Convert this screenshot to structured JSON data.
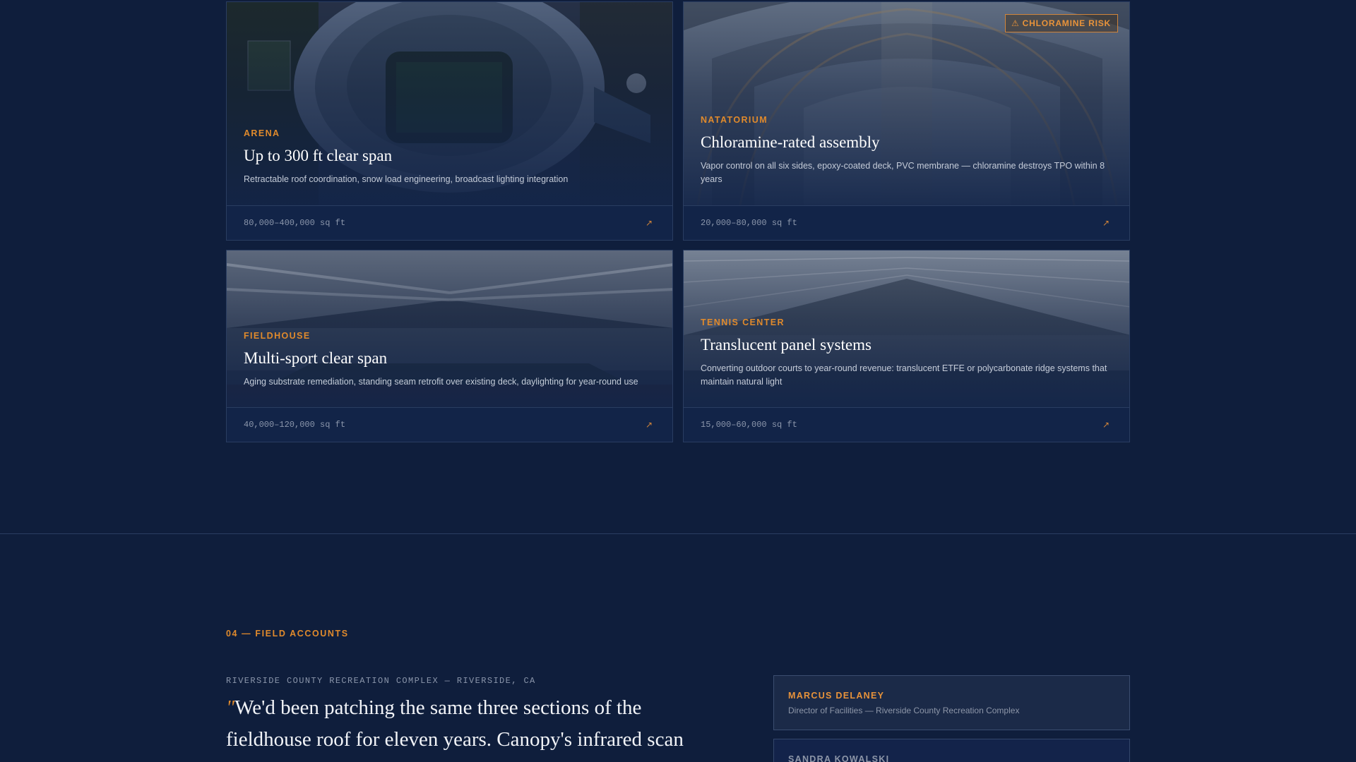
{
  "facilities": [
    {
      "category": "ARENA",
      "title": "Up to 300 ft clear span",
      "description": "Retractable roof coordination, snow load engineering, broadcast lighting integration",
      "size": "80,000–400,000 sq ft",
      "arrow": "↗"
    },
    {
      "category": "NATATORIUM",
      "title": "Chloramine-rated assembly",
      "description": "Vapor control on all six sides, epoxy-coated deck, PVC membrane — chloramine destroys TPO within 8 years",
      "size": "20,000–80,000 sq ft",
      "arrow": "↗",
      "badge": "⚠ CHLORAMINE RISK"
    },
    {
      "category": "FIELDHOUSE",
      "title": "Multi-sport clear span",
      "description": "Aging substrate remediation, standing seam retrofit over existing deck, daylighting for year-round use",
      "size": "40,000–120,000 sq ft",
      "arrow": "↗"
    },
    {
      "category": "TENNIS CENTER",
      "title": "Translucent panel systems",
      "description": "Converting outdoor courts to year-round revenue: translucent ETFE or polycarbonate ridge systems that maintain natural light",
      "size": "15,000–60,000 sq ft",
      "arrow": "↗"
    }
  ],
  "field_accounts": {
    "section_label": "04 — FIELD ACCOUNTS",
    "location": "RIVERSIDE COUNTY RECREATION COMPLEX — RIVERSIDE, CA",
    "quote_mark": "\"",
    "quote": "We'd been patching the same three sections of the fieldhouse roof for eleven years. Canopy's infrared scan",
    "people": [
      {
        "name": "MARCUS DELANEY",
        "role": "Director of Facilities — Riverside County Recreation Complex"
      },
      {
        "name": "SANDRA KOWALSKI",
        "role": ""
      }
    ]
  },
  "colors": {
    "background": "#0f1e3c",
    "accent": "#e08a2c",
    "border": "#2a3d61"
  }
}
